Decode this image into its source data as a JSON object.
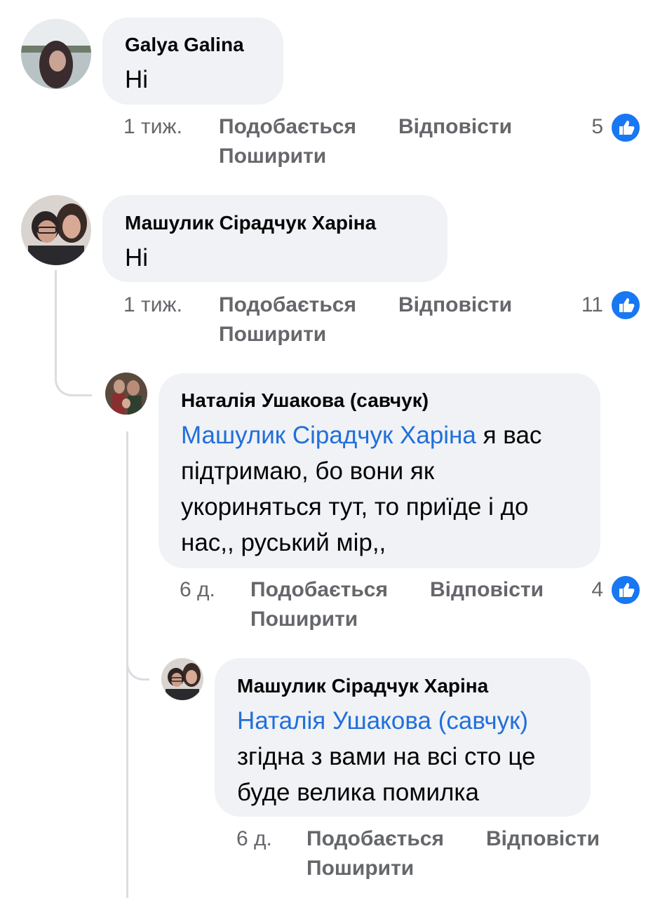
{
  "colors": {
    "mention": "#216fdb",
    "like_badge": "#1877f2",
    "bubble": "#f0f2f5",
    "meta": "#65676b"
  },
  "comments": [
    {
      "author": "Galya Galina",
      "text": "Ні",
      "time": "1 тиж.",
      "like_label": "Подобається",
      "reply_label": "Відповісти",
      "share_label": "Поширити",
      "reactions": "5"
    },
    {
      "author": "Машулик Сірадчук Харіна",
      "text": "Ні",
      "time": "1 тиж.",
      "like_label": "Подобається",
      "reply_label": "Відповісти",
      "share_label": "Поширити",
      "reactions": "11"
    },
    {
      "author": "Наталія Ушакова (савчук)",
      "mention": "Машулик Сірадчук Харіна",
      "text_line1": " я вас",
      "text_line2": "підтримаю, бо вони як",
      "text_line3": "укориняться тут, то приїде і до",
      "text_line4": "нас,, руський мір,,",
      "time": "6 д.",
      "like_label": "Подобається",
      "reply_label": "Відповісти",
      "share_label": "Поширити",
      "reactions": "4"
    },
    {
      "author": "Машулик Сірадчук Харіна",
      "mention": "Наталія Ушакова (савчук)",
      "text_line1": "згідна з вами на всі сто це",
      "text_line2": "буде велика помилка",
      "time": "6 д.",
      "like_label": "Подобається",
      "reply_label": "Відповісти",
      "share_label": "Поширити"
    }
  ]
}
